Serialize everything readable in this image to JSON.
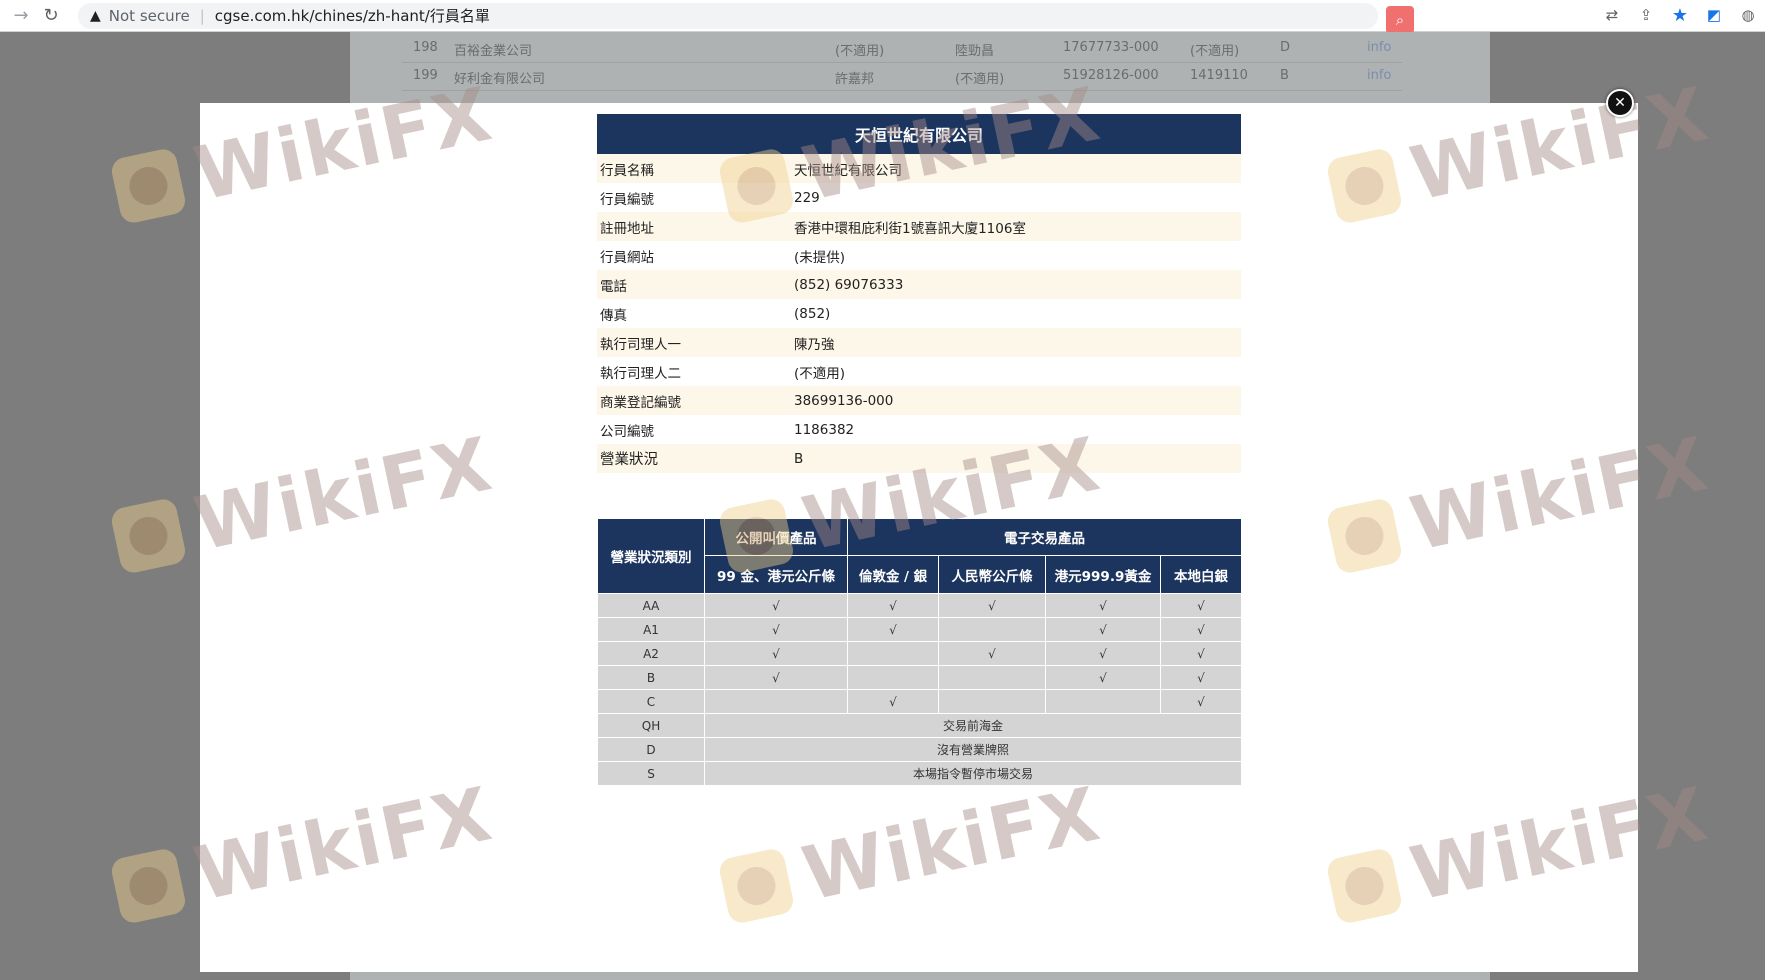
{
  "browser": {
    "security_label": "Not secure",
    "url": "cgse.com.hk/chines/zh-hant/行員名單"
  },
  "background_rows": [
    {
      "num": "198",
      "name": "百裕金業公司",
      "c1": "(不適用)",
      "c2": "陸勁昌",
      "c3": "17677733-000",
      "c4": "(不適用)",
      "c5": "D",
      "link": "info"
    },
    {
      "num": "199",
      "name": "好利金有限公司",
      "c1": "許嘉邦",
      "c2": "(不適用)",
      "c3": "51928126-000",
      "c4": "1419110",
      "c5": "B",
      "link": "info"
    }
  ],
  "member": {
    "title": "天恒世紀有限公司",
    "fields": [
      {
        "label": "行員名稱",
        "value": "天恒世紀有限公司"
      },
      {
        "label": "行員編號",
        "value": "229"
      },
      {
        "label": "註冊地址",
        "value": "香港中環租庇利街1號喜訊大廈1106室"
      },
      {
        "label": "行員網站",
        "value": "(未提供)"
      },
      {
        "label": "電話",
        "value": "(852) 69076333"
      },
      {
        "label": "傳真",
        "value": "(852)"
      },
      {
        "label": "執行司理人一",
        "value": "陳乃強"
      },
      {
        "label": "執行司理人二",
        "value": "(不適用)"
      },
      {
        "label": "商業登記編號",
        "value": "38699136-000"
      },
      {
        "label": "公司編號",
        "value": "1186382"
      },
      {
        "label": "營業狀況",
        "value": "B"
      }
    ]
  },
  "status_table": {
    "category_header": "營業狀況類別",
    "group_public": "公開叫價產品",
    "group_electronic": "電子交易產品",
    "columns": [
      "99 金、港元公斤條",
      "倫敦金 / 銀",
      "人民幣公斤條",
      "港元999.9黃金",
      "本地白銀"
    ],
    "rows": [
      {
        "cat": "AA",
        "cells": [
          "√",
          "√",
          "√",
          "√",
          "√"
        ]
      },
      {
        "cat": "A1",
        "cells": [
          "√",
          "√",
          "",
          "√",
          "√"
        ]
      },
      {
        "cat": "A2",
        "cells": [
          "√",
          "",
          "√",
          "√",
          "√"
        ]
      },
      {
        "cat": "B",
        "cells": [
          "√",
          "",
          "",
          "√",
          "√"
        ]
      },
      {
        "cat": "C",
        "cells": [
          "",
          "√",
          "",
          "",
          "√"
        ]
      }
    ],
    "notes": [
      {
        "cat": "QH",
        "text": "交易前海金"
      },
      {
        "cat": "D",
        "text": "沒有營業牌照"
      },
      {
        "cat": "S",
        "text": "本場指令暫停市場交易"
      }
    ]
  },
  "watermark": {
    "text": "WikiFX"
  }
}
